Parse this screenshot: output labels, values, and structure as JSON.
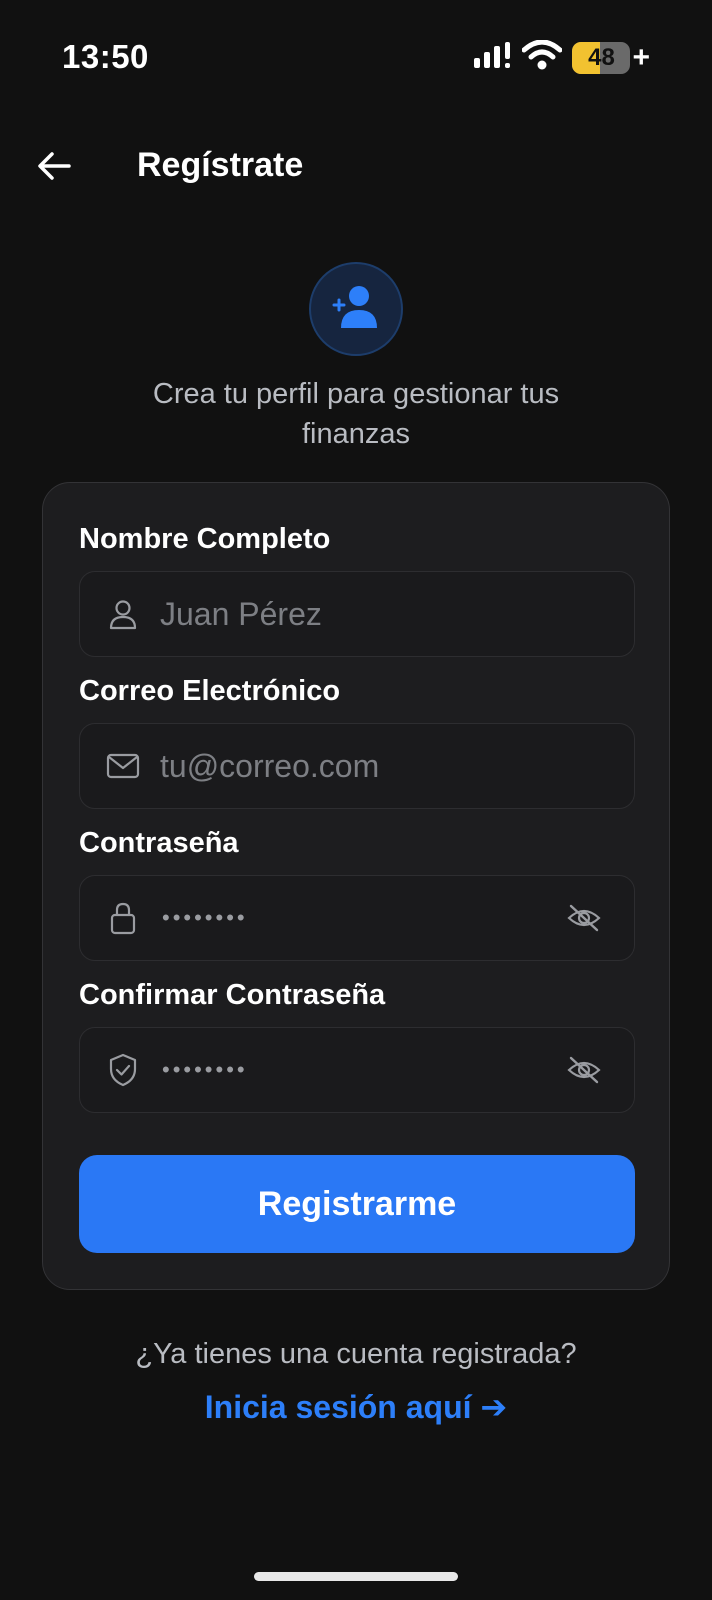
{
  "status_bar": {
    "time": "13:50",
    "battery_level": "48",
    "battery_percent": 48,
    "battery_charging_symbol": "+",
    "icons": [
      "cellular-signal-icon",
      "wifi-icon",
      "battery-icon"
    ]
  },
  "header": {
    "title": "Regístrate",
    "back_icon": "arrow-left-icon"
  },
  "hero": {
    "icon": "add-user-icon",
    "subtitle": "Crea tu perfil para gestionar tus finanzas"
  },
  "form": {
    "full_name": {
      "label": "Nombre Completo",
      "placeholder": "Juan Pérez",
      "value": "",
      "icon": "user-icon"
    },
    "email": {
      "label": "Correo Electrónico",
      "placeholder": "tu@correo.com",
      "value": "",
      "icon": "mail-icon"
    },
    "password": {
      "label": "Contraseña",
      "masked_value": "••••••••",
      "icon": "lock-icon",
      "toggle_icon": "eye-off-icon"
    },
    "confirm_password": {
      "label": "Confirmar Contraseña",
      "masked_value": "••••••••",
      "icon": "shield-check-icon",
      "toggle_icon": "eye-off-icon"
    },
    "submit_label": "Registrarme"
  },
  "footer": {
    "question": "¿Ya tienes una cuenta registrada?",
    "login_link": "Inicia sesión aquí ➔"
  },
  "colors": {
    "background": "#111111",
    "card": "#1d1d1f",
    "accent": "#2a78f5",
    "link": "#2d7ff9",
    "battery": "#f2c230"
  }
}
